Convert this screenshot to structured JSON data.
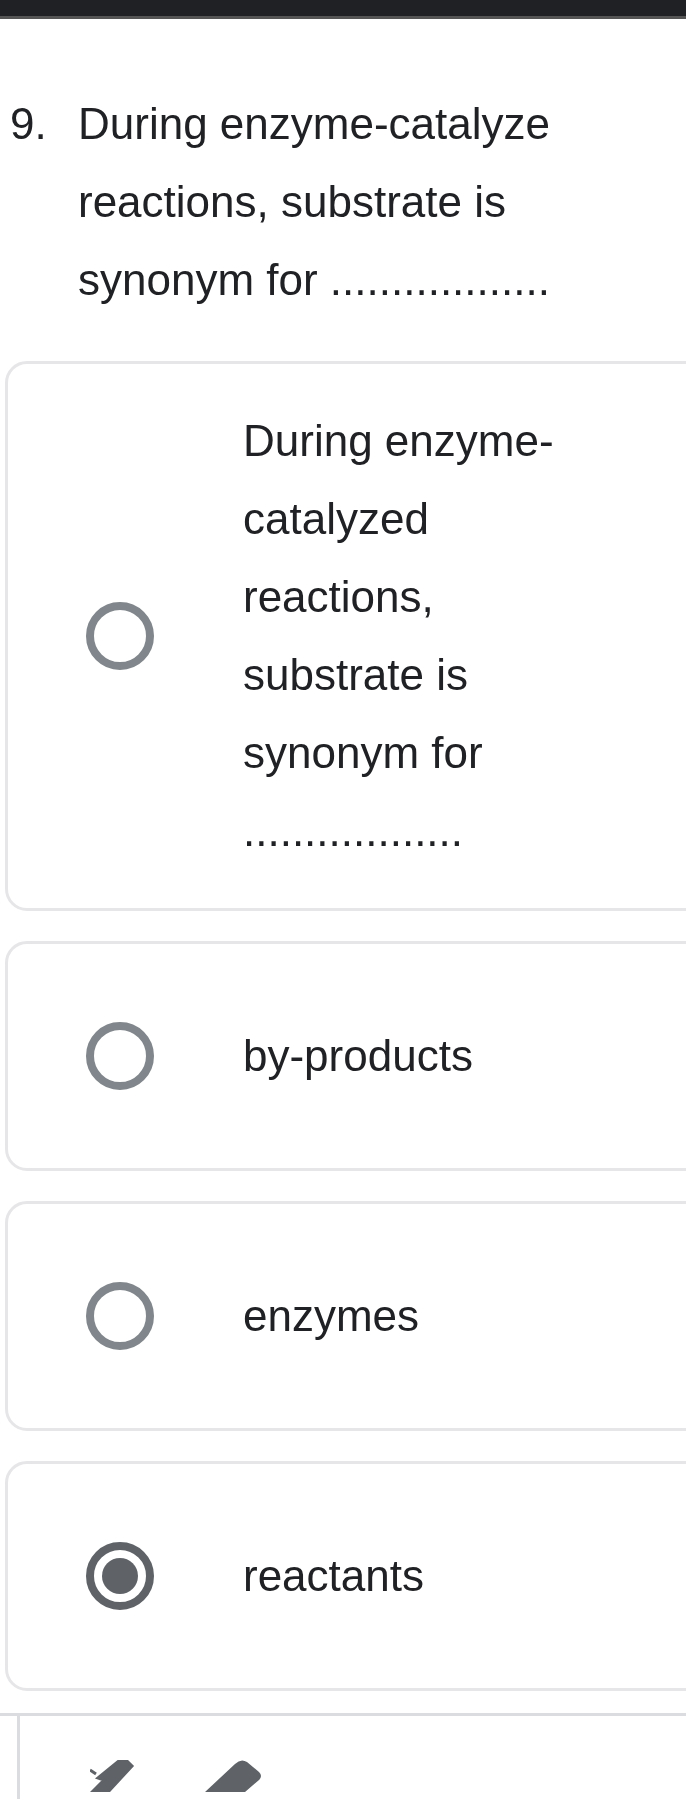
{
  "question": {
    "number": "9.",
    "lines": [
      "During enzyme-catalyze",
      "reactions, substrate is",
      "synonym for .................."
    ]
  },
  "options": [
    {
      "lines": [
        "During enzyme-",
        "catalyzed",
        "reactions,",
        "substrate is",
        "synonym for",
        ".................."
      ],
      "selected": false
    },
    {
      "lines": [
        "by-products"
      ],
      "selected": false
    },
    {
      "lines": [
        "enzymes"
      ],
      "selected": false
    },
    {
      "lines": [
        "reactants"
      ],
      "selected": true
    }
  ]
}
